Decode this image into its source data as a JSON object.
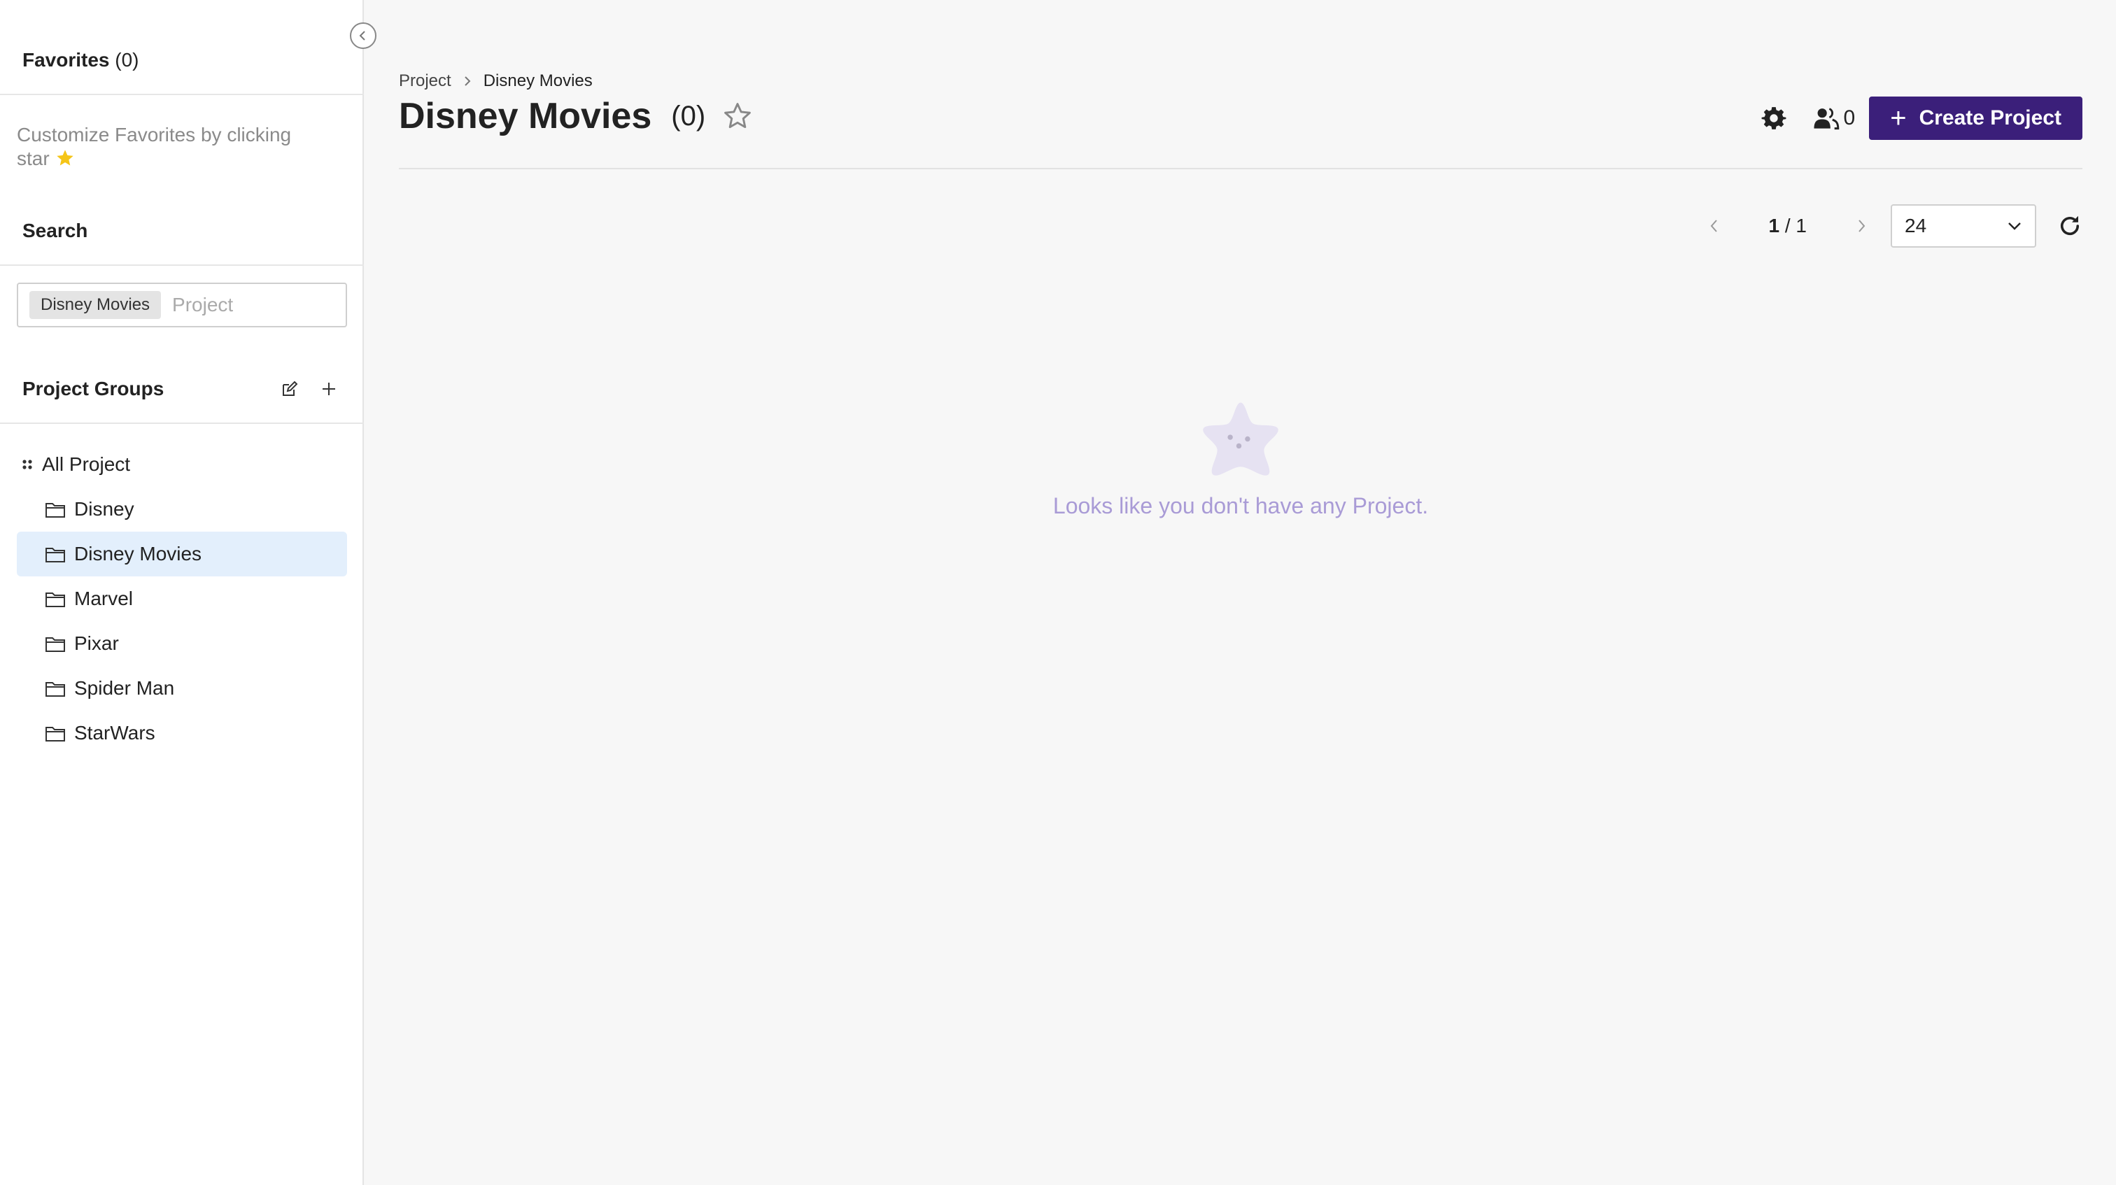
{
  "sidebar": {
    "favorites": {
      "title": "Favorites",
      "count": "(0)",
      "hint": "Customize Favorites by clicking star"
    },
    "search": {
      "title": "Search",
      "tag": "Disney Movies",
      "placeholder": "Project"
    },
    "project_groups": {
      "title": "Project Groups",
      "root_label": "All Project",
      "items": [
        {
          "label": "Disney"
        },
        {
          "label": "Disney Movies",
          "selected": true
        },
        {
          "label": "Marvel"
        },
        {
          "label": "Pixar"
        },
        {
          "label": "Spider Man"
        },
        {
          "label": "StarWars"
        }
      ]
    }
  },
  "main": {
    "breadcrumb": [
      "Project",
      "Disney Movies"
    ],
    "title": "Disney Movies",
    "count": "(0)",
    "member_count": "0",
    "create_button": "Create Project",
    "pagination": {
      "current": "1",
      "total": "1",
      "separator": "/"
    },
    "page_size": "24",
    "empty_message": "Looks like you don't have any Project."
  },
  "colors": {
    "primary": "#3b1f7a",
    "selected_bg": "#e3effc",
    "empty_text": "#a99bd6",
    "star_emoji": "#f5c518"
  }
}
